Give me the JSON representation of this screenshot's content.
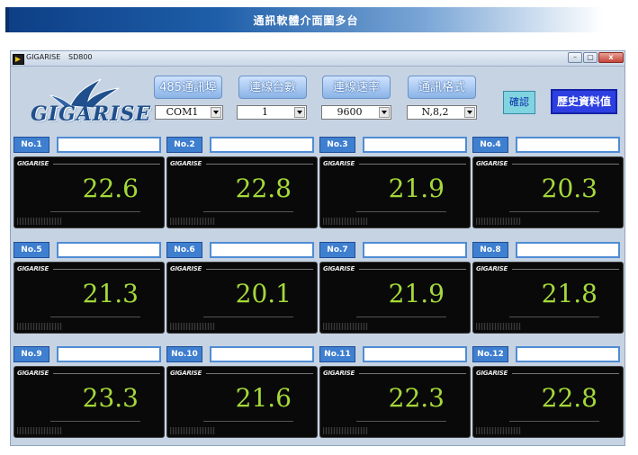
{
  "banner": {
    "title": "通訊軟體介面圖多台"
  },
  "window": {
    "title": "GIGARISE",
    "model": "SD800",
    "minimize": "–",
    "maximize": "▢",
    "close": "x"
  },
  "logo": {
    "text": "GIGARISE"
  },
  "settings": {
    "port": {
      "label": "485通訊埠",
      "value": "COM1"
    },
    "units": {
      "label": "連線台數",
      "value": "1"
    },
    "baud": {
      "label": "連線速率",
      "value": "9600"
    },
    "format": {
      "label": "通訊格式",
      "value": "N,8,2"
    },
    "confirm": "確認",
    "history": "歷史資料值"
  },
  "devices": [
    {
      "label": "No.1",
      "brand": "GIGARISE",
      "reading": "22.6"
    },
    {
      "label": "No.2",
      "brand": "GIGARISE",
      "reading": "22.8"
    },
    {
      "label": "No.3",
      "brand": "GIGARISE",
      "reading": "21.9"
    },
    {
      "label": "No.4",
      "brand": "GIGARISE",
      "reading": "20.3"
    },
    {
      "label": "No.5",
      "brand": "GIGARISE",
      "reading": "21.3"
    },
    {
      "label": "No.6",
      "brand": "GIGARISE",
      "reading": "20.1"
    },
    {
      "label": "No.7",
      "brand": "GIGARISE",
      "reading": "21.9"
    },
    {
      "label": "No.8",
      "brand": "GIGARISE",
      "reading": "21.8"
    },
    {
      "label": "No.9",
      "brand": "GIGARISE",
      "reading": "23.3"
    },
    {
      "label": "No.10",
      "brand": "GIGARISE",
      "reading": "21.6"
    },
    {
      "label": "No.11",
      "brand": "GIGARISE",
      "reading": "22.3"
    },
    {
      "label": "No.12",
      "brand": "GIGARISE",
      "reading": "22.8"
    }
  ]
}
